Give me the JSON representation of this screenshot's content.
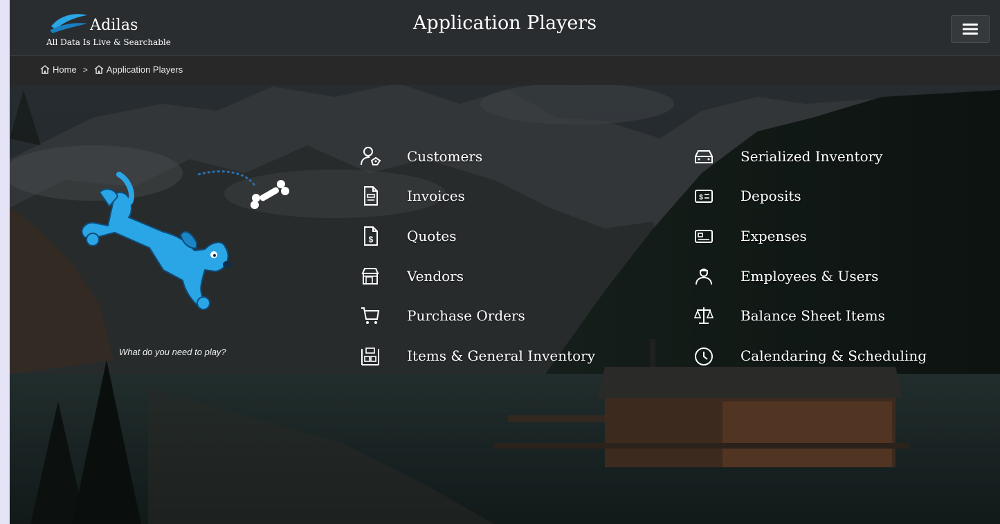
{
  "brand": {
    "name": "Adilas",
    "tagline": "All Data Is Live & Searchable",
    "accent": "#2aa6e6"
  },
  "header": {
    "title": "Application Players",
    "menu_icon": "hamburger-icon"
  },
  "breadcrumb": {
    "items": [
      {
        "label": "Home",
        "icon": "home-icon"
      },
      {
        "label": "Application Players",
        "icon": "home-icon"
      }
    ],
    "separator": ">"
  },
  "hero": {
    "tagline": "What do you need to play?",
    "mascot": "blue-dog-with-bone"
  },
  "menu": {
    "left": [
      {
        "label": "Customers",
        "icon": "user-tag-icon"
      },
      {
        "label": "Invoices",
        "icon": "document-icon"
      },
      {
        "label": "Quotes",
        "icon": "dollar-document-icon"
      },
      {
        "label": "Vendors",
        "icon": "storefront-icon"
      },
      {
        "label": "Purchase Orders",
        "icon": "cart-icon"
      },
      {
        "label": "Items & General Inventory",
        "icon": "inventory-shelf-icon"
      }
    ],
    "right": [
      {
        "label": "Serialized Inventory",
        "icon": "car-icon"
      },
      {
        "label": "Deposits",
        "icon": "cash-icon"
      },
      {
        "label": "Expenses",
        "icon": "card-icon"
      },
      {
        "label": "Employees & Users",
        "icon": "employee-icon"
      },
      {
        "label": "Balance Sheet Items",
        "icon": "scale-icon"
      },
      {
        "label": "Calendaring & Scheduling",
        "icon": "clock-icon"
      }
    ]
  },
  "colors": {
    "topbar": "#2a2d30",
    "breadcrumb_bg": "#282828",
    "text": "#ffffff",
    "mascot_blue": "#2aa6e6"
  }
}
